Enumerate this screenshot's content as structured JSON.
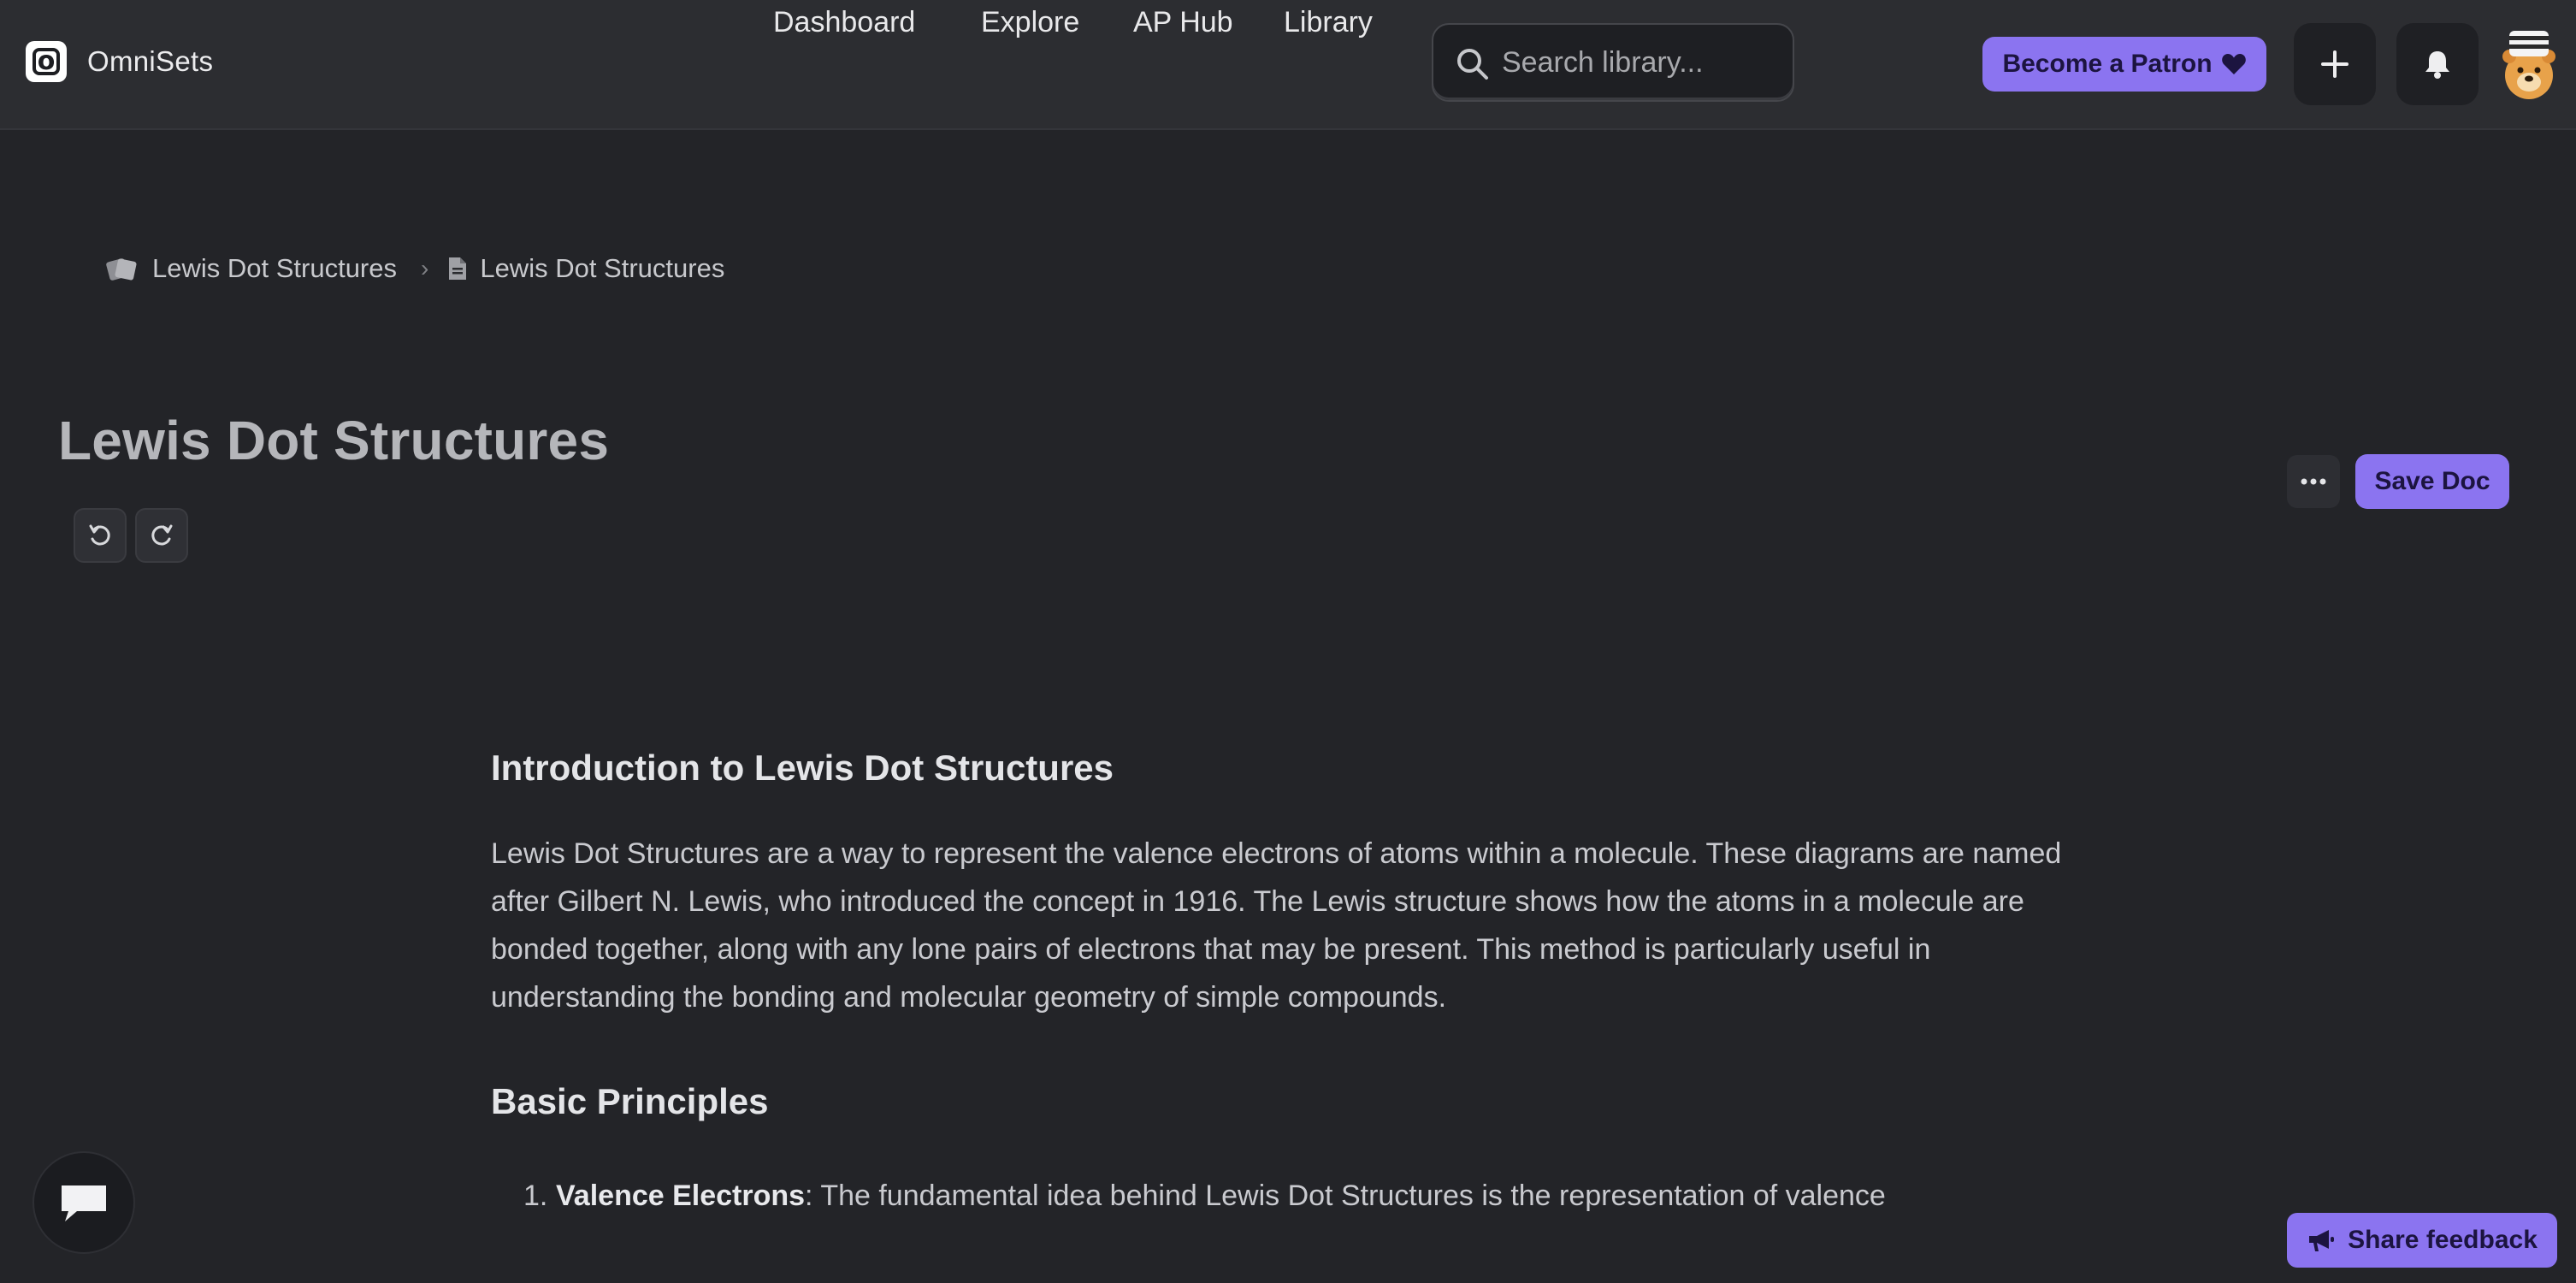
{
  "app": {
    "name": "OmniSets"
  },
  "nav": {
    "items": [
      {
        "label": "Dashboard"
      },
      {
        "label": "Explore"
      },
      {
        "label": "AP Hub"
      },
      {
        "label": "Library"
      }
    ]
  },
  "search": {
    "placeholder": "Search library..."
  },
  "header": {
    "patron_label": "Become a Patron",
    "icons": [
      "plus-icon",
      "bell-icon"
    ]
  },
  "breadcrumb": {
    "items": [
      {
        "label": "Lewis Dot Structures",
        "icon": "cards-icon"
      },
      {
        "label": "Lewis Dot Structures",
        "icon": "document-icon"
      }
    ]
  },
  "doc": {
    "title": "Lewis Dot Structures",
    "save_label": "Save Doc",
    "sections": [
      {
        "heading": "Introduction to Lewis Dot Structures",
        "paragraph": "Lewis Dot Structures are a way to represent the valence electrons of atoms within a molecule. These diagrams are named after Gilbert N. Lewis, who introduced the concept in 1916. The Lewis structure shows how the atoms in a molecule are bonded together, along with any lone pairs of electrons that may be present. This method is particularly useful in understanding the bonding and molecular geometry of simple compounds."
      },
      {
        "heading": "Basic Principles",
        "list": [
          {
            "num": "1.",
            "term": "Valence Electrons",
            "text": ": The fundamental idea behind Lewis Dot Structures is the representation of valence"
          }
        ]
      }
    ]
  },
  "feedback": {
    "label": "Share feedback"
  },
  "colors": {
    "accent": "#8b74f0",
    "background": "#232428",
    "topbar": "#2c2d31"
  }
}
